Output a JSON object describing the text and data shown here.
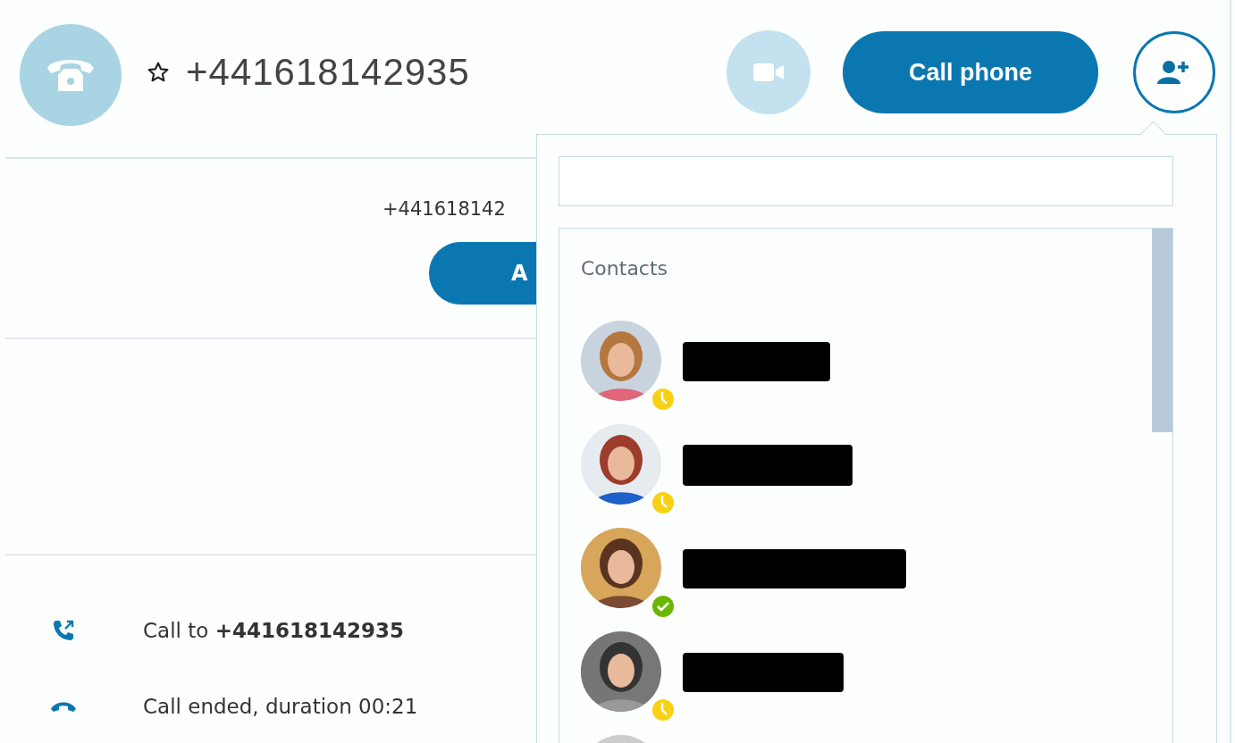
{
  "header": {
    "title": "+441618142935",
    "favorite": false
  },
  "video_button": {
    "disabled": true
  },
  "call_button": {
    "label": "Call phone"
  },
  "profile": {
    "number": "+441618142",
    "add_button": "A"
  },
  "history": [
    {
      "kind": "outgoing",
      "text": "Call to **+441618142935**"
    },
    {
      "kind": "ended",
      "text": "Call ended, duration 00:21"
    }
  ],
  "add_popup": {
    "section": "Contacts",
    "contacts": [
      {
        "kind": "away",
        "color": "#f8d117"
      },
      {
        "kind": "away",
        "color": "#f8d117"
      },
      {
        "kind": "online",
        "color": "#6bb700"
      },
      {
        "kind": "away",
        "color": "#f8d117"
      },
      {
        "kind": "picture"
      }
    ]
  }
}
